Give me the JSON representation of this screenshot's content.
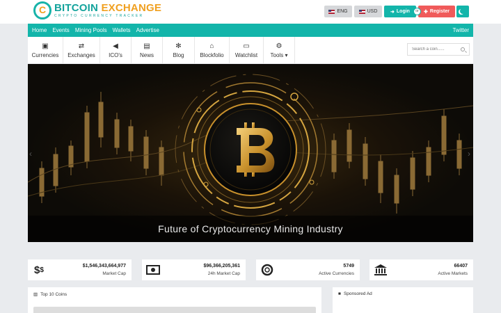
{
  "brand": {
    "title_part1": "BITCOIN",
    "title_part2": "EXCHANGE",
    "tagline": "CRYPTO CURRENCY TRACKER"
  },
  "header": {
    "language": "ENG",
    "currency": "USD",
    "login_label": "Login",
    "or_label": "or",
    "register_label": "Register"
  },
  "nav": {
    "links": [
      "Home",
      "Events",
      "Mining Pools",
      "Wallets",
      "Advertise"
    ],
    "right_link": "Twitter"
  },
  "menu": {
    "items": [
      {
        "label": "Currencies",
        "icon": "money-icon"
      },
      {
        "label": "Exchanges",
        "icon": "exchange-icon"
      },
      {
        "label": "ICO's",
        "icon": "megaphone-icon"
      },
      {
        "label": "News",
        "icon": "newspaper-icon"
      },
      {
        "label": "Blog",
        "icon": "pinwheel-icon"
      },
      {
        "label": "Blockfolio",
        "icon": "bank-icon"
      },
      {
        "label": "Watchlist",
        "icon": "monitor-icon"
      },
      {
        "label": "Tools",
        "icon": "cogs-icon"
      }
    ]
  },
  "search": {
    "placeholder": "Search a coin......"
  },
  "hero": {
    "caption": "Future of Cryptocurrency Mining Industry",
    "colors": {
      "gold": "#d6a640",
      "dark": "#0d0b07"
    }
  },
  "stats": [
    {
      "icon": "dollar-icon",
      "value": "$1,546,343,664,977",
      "label": "Market Cap"
    },
    {
      "icon": "banknote-icon",
      "value": "$96,366,205,361",
      "label": "24h Market Cap"
    },
    {
      "icon": "lifebuoy-icon",
      "value": "5749",
      "label": "Active Currencies"
    },
    {
      "icon": "bank-icon",
      "value": "66407",
      "label": "Active Markets"
    }
  ],
  "panels": {
    "top_coins_title": "Top 10 Coins",
    "sponsored_title": "Sponsored Ad"
  },
  "colors": {
    "accent": "#13b5aa",
    "register": "#f05a5a",
    "background": "#e9ebee"
  }
}
